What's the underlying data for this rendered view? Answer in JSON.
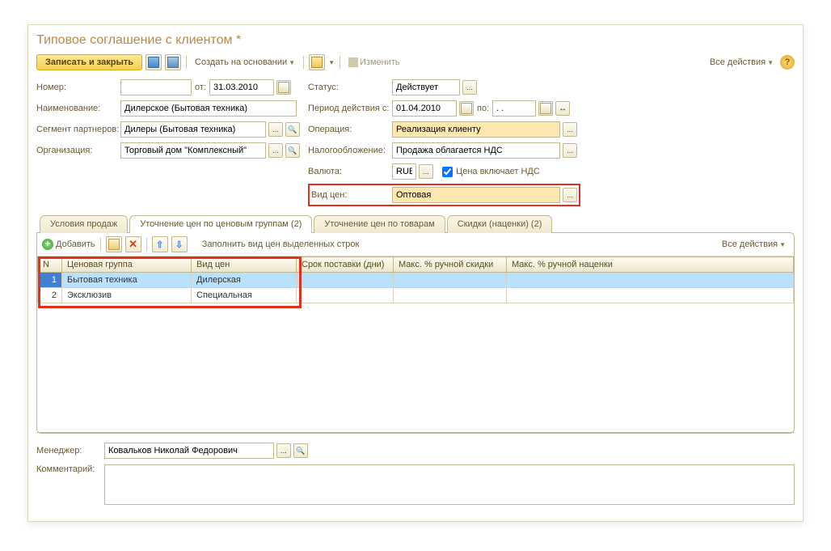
{
  "title": "Типовое соглашение с клиентом *",
  "toolbar": {
    "save_close": "Записать и закрыть",
    "create_based": "Создать на основании",
    "edit": "Изменить",
    "all_actions": "Все действия"
  },
  "form": {
    "number_lbl": "Номер:",
    "number_val": "",
    "from_lbl": "от:",
    "from_val": "31.03.2010",
    "name_lbl": "Наименование:",
    "name_val": "Дилерское (Бытовая техника)",
    "segment_lbl": "Сегмент партнеров:",
    "segment_val": "Дилеры (Бытовая техника)",
    "org_lbl": "Организация:",
    "org_val": "Торговый дом \"Комплексный\"",
    "status_lbl": "Статус:",
    "status_val": "Действует",
    "period_lbl": "Период действия с:",
    "period_from": "01.04.2010",
    "period_to_lbl": "по:",
    "period_to": ". .",
    "operation_lbl": "Операция:",
    "operation_val": "Реализация клиенту",
    "tax_lbl": "Налогообложение:",
    "tax_val": "Продажа облагается НДС",
    "currency_lbl": "Валюта:",
    "currency_val": "RUB",
    "price_incl_vat": "Цена включает НДС",
    "price_type_lbl": "Вид цен:",
    "price_type_val": "Оптовая"
  },
  "tabs": {
    "t1": "Условия продаж",
    "t2": "Уточнение цен по ценовым группам (2)",
    "t3": "Уточнение цен по товарам",
    "t4": "Скидки (наценки) (2)"
  },
  "tab_toolbar": {
    "add": "Добавить",
    "fill": "Заполнить вид цен выделенных строк",
    "all_actions": "Все действия"
  },
  "columns": {
    "n": "N",
    "group": "Ценовая группа",
    "price_type": "Вид цен",
    "delivery": "Срок поставки (дни)",
    "max_discount": "Макс. % ручной скидки",
    "max_markup": "Макс. % ручной наценки"
  },
  "rows": [
    {
      "n": "1",
      "group": "Бытовая техника",
      "price_type": "Дилерская"
    },
    {
      "n": "2",
      "group": "Эксклюзив",
      "price_type": "Специальная"
    }
  ],
  "bottom": {
    "manager_lbl": "Менеджер:",
    "manager_val": "Ковальков Николай Федорович",
    "comment_lbl": "Комментарий:",
    "comment_val": ""
  }
}
